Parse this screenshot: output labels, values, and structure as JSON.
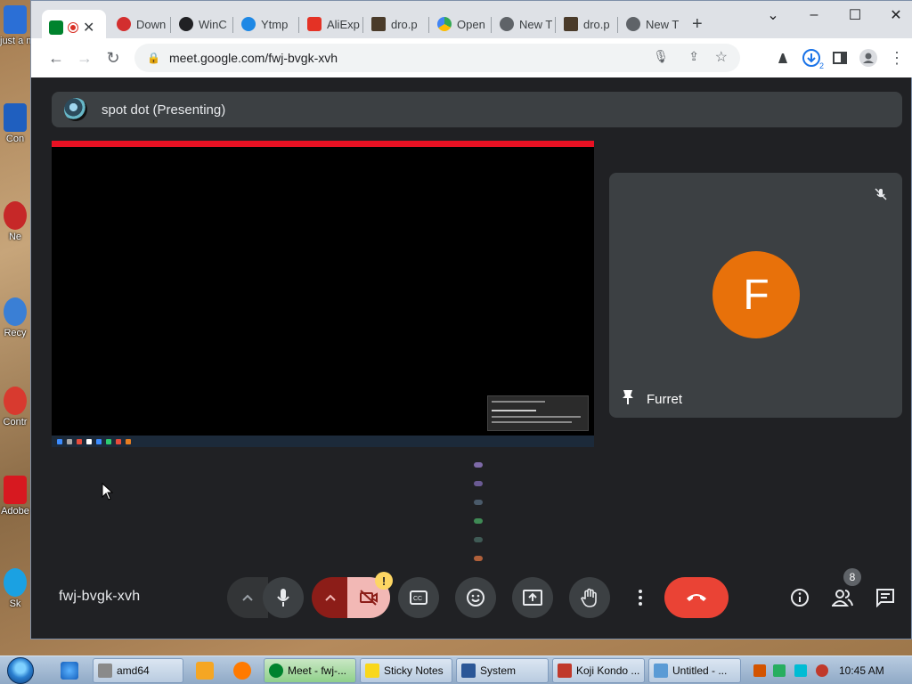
{
  "desktop": {
    "icons": [
      {
        "label": "just a m",
        "color": "#2b6fd6"
      },
      {
        "label": "Con",
        "color": "#1f5fbf"
      },
      {
        "label": "Ne",
        "color": "#c62828"
      },
      {
        "label": "Recy",
        "color": "#3a7fd5"
      },
      {
        "label": "Contr",
        "color": "#d83a2f"
      },
      {
        "label": "Adobe",
        "color": "#d71920"
      },
      {
        "label": "Sk",
        "color": "#1ba1e2"
      }
    ]
  },
  "browser": {
    "tabs": [
      {
        "label": "",
        "favicon": "meet-icon",
        "color": "#00832d"
      },
      {
        "label": "Down",
        "favicon": "opera-icon",
        "color": "#d32f2f"
      },
      {
        "label": "WinC",
        "favicon": "gear-icon",
        "color": "#202124"
      },
      {
        "label": "Ytmp",
        "favicon": "ytmp-icon",
        "color": "#1e88e5"
      },
      {
        "label": "AliExp",
        "favicon": "aliexpress-icon",
        "color": "#e43225"
      },
      {
        "label": "dro.p",
        "favicon": "terminal-icon",
        "color": "#4a3b2a"
      },
      {
        "label": "Open",
        "favicon": "drive-icon",
        "color": "#34a853"
      },
      {
        "label": "New T",
        "favicon": "chrome-icon",
        "color": "#5f6368"
      },
      {
        "label": "dro.p",
        "favicon": "terminal-icon",
        "color": "#4a3b2a"
      },
      {
        "label": "New T",
        "favicon": "chrome-icon",
        "color": "#5f6368"
      }
    ],
    "new_tab_label": "+",
    "url": "meet.google.com/fwj-bvgk-xvh",
    "download_count": "2"
  },
  "meet": {
    "presenting_label": "spot dot (Presenting)",
    "participant": {
      "name": "Furret",
      "initial": "F",
      "avatar_color": "#e8710a"
    },
    "meeting_code": "fwj-bvgk-xvh",
    "people_count": "8",
    "warning_badge": "!",
    "colors": {
      "background": "#202124",
      "tile": "#3c4043",
      "end_call": "#ea4335",
      "camera_off": "#f2b8b5"
    }
  },
  "taskbar": {
    "buttons": [
      {
        "label": "amd64",
        "active": false,
        "color": "#8a8a8a"
      },
      {
        "label": "Meet - fwj-...",
        "active": true,
        "color": "#00832d"
      },
      {
        "label": "Sticky Notes",
        "active": false,
        "color": "#f9d71c"
      },
      {
        "label": "System",
        "active": false,
        "color": "#2b5797"
      },
      {
        "label": "Koji Kondo ...",
        "active": false,
        "color": "#c0392b"
      },
      {
        "label": "Untitled - ...",
        "active": false,
        "color": "#5b9bd5"
      }
    ],
    "clock": "10:45 AM"
  }
}
